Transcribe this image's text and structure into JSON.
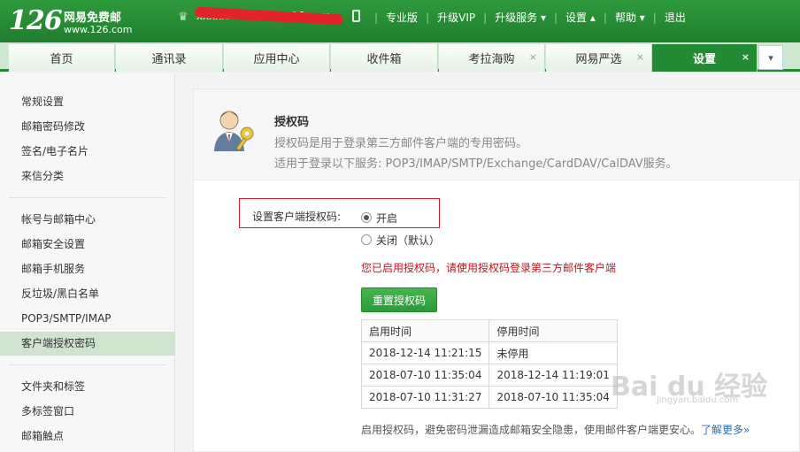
{
  "header": {
    "logo_number": "126",
    "logo_text": "网易免费邮",
    "logo_url": "www.126.com",
    "user_email": "xxxxxxxx2018@126.com",
    "links": [
      "专业版",
      "升级VIP",
      "升级服务 ▾",
      "设置 ▴",
      "帮助 ▾",
      "退出"
    ]
  },
  "tabs": [
    {
      "label": "首页",
      "closable": false
    },
    {
      "label": "通讯录",
      "closable": false
    },
    {
      "label": "应用中心",
      "closable": false
    },
    {
      "label": "收件箱",
      "closable": false
    },
    {
      "label": "考拉海购",
      "closable": true
    },
    {
      "label": "网易严选",
      "closable": true
    },
    {
      "label": "设置",
      "closable": true,
      "active": true
    }
  ],
  "tab_close_glyph": "×",
  "tab_more_glyph": "▾",
  "sidebar": {
    "items": [
      "常规设置",
      "邮箱密码修改",
      "签名/电子名片",
      "来信分类",
      "帐号与邮箱中心",
      "邮箱安全设置",
      "邮箱手机服务",
      "反垃圾/黑白名单",
      "POP3/SMTP/IMAP",
      "客户端授权密码",
      "文件夹和标签",
      "多标签窗口",
      "邮箱触点"
    ],
    "active": "客户端授权密码"
  },
  "intro": {
    "title": "授权码",
    "description": "授权码是用于登录第三方邮件客户端的专用密码。",
    "services": "适用于登录以下服务: POP3/IMAP/SMTP/Exchange/CardDAV/CalDAV服务。"
  },
  "setting": {
    "label": "设置客户端授权码:",
    "option_on": "开启",
    "option_off": "关闭（默认）",
    "selected": "开启"
  },
  "notice": "您已启用授权码，请使用授权码登录第三方邮件客户端",
  "reset_button": "重置授权码",
  "history": {
    "headers": [
      "启用时间",
      "停用时间"
    ],
    "rows": [
      [
        "2018-12-14 11:21:15",
        "未停用"
      ],
      [
        "2018-07-10 11:35:04",
        "2018-12-14 11:19:01"
      ],
      [
        "2018-07-10 11:31:27",
        "2018-07-10 11:35:04"
      ]
    ]
  },
  "footnote": "启用授权码，避免密码泄漏造成邮箱安全隐患，使用邮件客户端更安心。",
  "footnote_link": "了解更多»",
  "watermark": "Bai du 经验",
  "watermark_sub": "jingyan.baidu.com",
  "colors": {
    "brand_green": "#228a32",
    "notice_red": "#c0161f",
    "highlight_box": "#d71c28"
  }
}
